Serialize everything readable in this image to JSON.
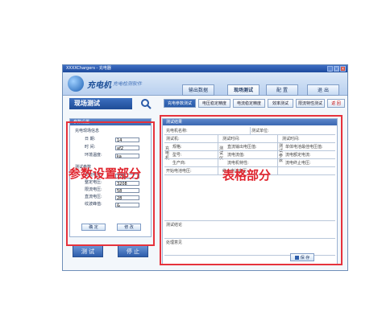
{
  "window": {
    "title": "XXXXChargers - 充电器",
    "minimize": "_",
    "maximize": "□",
    "close": "×"
  },
  "header": {
    "logo_text": "充电机",
    "logo_sub": "充电检测软件"
  },
  "nav": [
    "输出数据",
    "现场测试",
    "配 置",
    "退 出"
  ],
  "page": {
    "title": "现场测试"
  },
  "tabs": [
    "充电参数测试",
    "电压稳定精度",
    "电流稳定精度",
    "效率测试",
    "限流特性测试",
    "返 回"
  ],
  "params": {
    "head": "参数设置",
    "group1": "充电现场信息",
    "date_label": "日 期:",
    "date_value": "14",
    "time_label": "时 间:",
    "time_value": "af2",
    "temp_label": "环境温度:",
    "temp_value": "ka",
    "group2": "测试参数",
    "ac_v_label": "交流电压:",
    "ac_v_value": "120",
    "set_v_label": "整定电压:",
    "set_v_value": "3208",
    "limit_v_label": "限流电压:",
    "limit_v_value": "58",
    "dc_v_label": "直流电压:",
    "dc_v_value": "28",
    "ripple_label": "纹波峰值:",
    "ripple_value": "&",
    "ok_label": "确 定",
    "edit_label": "修 改"
  },
  "table": {
    "head": "测试结果",
    "row1": [
      "充电机名称:",
      "测试单位:"
    ],
    "row2": [
      "测试机:",
      "测试时间:",
      "测试时间:"
    ],
    "side1": "充电机",
    "side2": "测试仪",
    "side3": "测试参数",
    "row3": [
      "规格:",
      "直流输出电压值:",
      "单体电池最佳电压值:"
    ],
    "row4": [
      "型号:",
      "流电流值:",
      "流电额定电流:"
    ],
    "row5": [
      "生产商:",
      "流电机特性:",
      "流电终止电压:"
    ],
    "row6": [
      "开始电池电压:",
      "终止电池电压:"
    ],
    "conclusion": "测试结论",
    "handling": "处理意见",
    "save_label": "保 存"
  },
  "footer": {
    "test_label": "测 试",
    "stop_label": "停 止"
  },
  "annotations": {
    "left": "参数设置部分",
    "right": "表格部分"
  }
}
